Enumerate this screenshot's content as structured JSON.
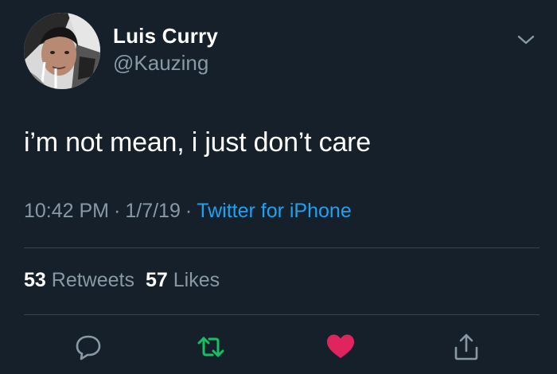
{
  "user": {
    "name": "Luis Curry",
    "handle": "@Kauzing"
  },
  "tweet": {
    "text": "i’m not mean, i just don’t care",
    "time": "10:42 PM",
    "date": "1/7/19",
    "source": "Twitter for iPhone",
    "separator": "·"
  },
  "stats": {
    "retweets_count": "53",
    "retweets_label": "Retweets",
    "likes_count": "57",
    "likes_label": "Likes"
  },
  "icons": {
    "more": "chevron-down-icon",
    "reply": "reply-icon",
    "retweet": "retweet-icon",
    "like": "heart-icon",
    "share": "share-icon"
  },
  "colors": {
    "background": "#15202b",
    "secondary_text": "#8899a6",
    "link": "#1da1f2",
    "retweet_active": "#17bf63",
    "like_active": "#e0245e",
    "divider": "#38444d"
  }
}
